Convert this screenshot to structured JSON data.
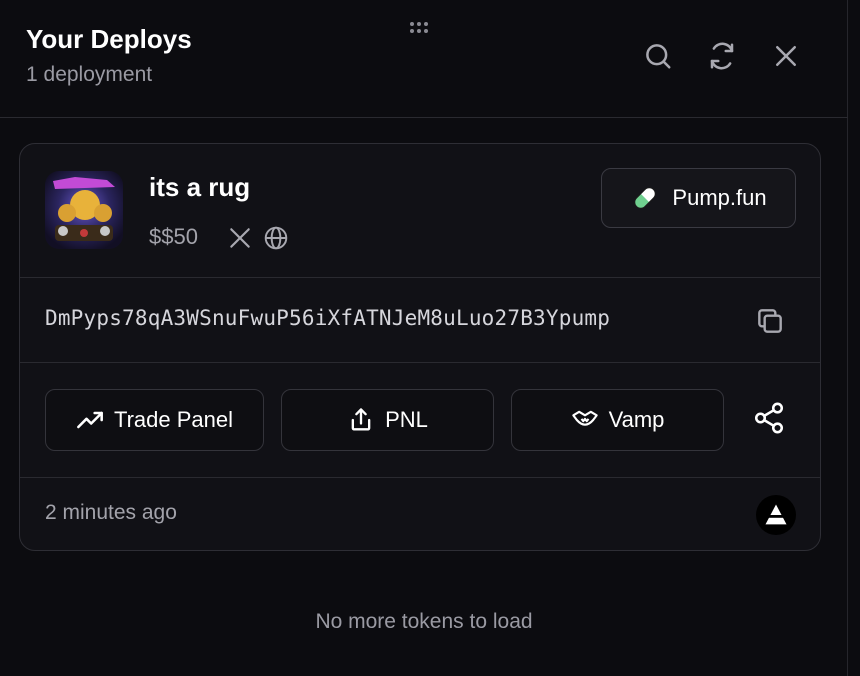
{
  "header": {
    "title": "Your Deploys",
    "subtitle": "1 deployment",
    "icons": [
      "search-icon",
      "refresh-icon",
      "close-icon"
    ]
  },
  "card": {
    "token_name": "its a rug",
    "ticker": "$$50",
    "socials": [
      "x-twitter-icon",
      "globe-icon"
    ],
    "platform_label": "Pump.fun",
    "contract_address": "DmPyps78qA3WSnuFwuP56iXfATNJeM8uLuo27B3Ypump",
    "actions": [
      {
        "label": "Trade Panel",
        "icon": "trending-up-icon"
      },
      {
        "label": "PNL",
        "icon": "upload-share-icon"
      },
      {
        "label": "Vamp",
        "icon": "vamp-icon"
      }
    ],
    "time_ago": "2 minutes ago"
  },
  "footer": {
    "message": "No more tokens to load"
  },
  "colors": {
    "background": "#0c0c10",
    "card": "#111116",
    "border": "#2e2e35",
    "pill_green": "#6fcf8f"
  }
}
